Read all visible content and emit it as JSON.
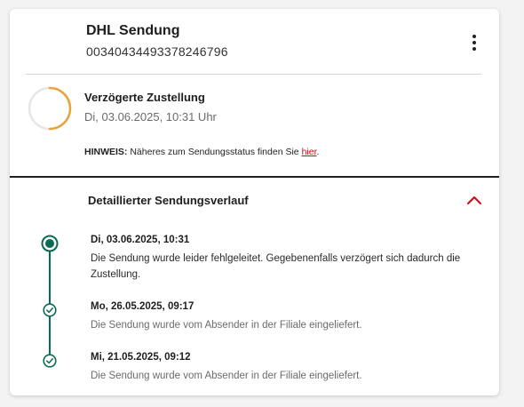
{
  "shipment": {
    "title": "DHL Sendung",
    "tracking_number": "00340434493378246796",
    "menu_icon": "more-vert-icon"
  },
  "status": {
    "title": "Verzögerte Zustellung",
    "date": "Di, 03.06.2025, 10:31 Uhr",
    "ring_color": "#e8a33d",
    "ring_track_color": "#e6e6e6"
  },
  "hint": {
    "label": "HINWEIS:",
    "text": "Näheres zum Sendungsstatus finden Sie",
    "link": "hier",
    "suffix": ".",
    "link_color": "#d40511"
  },
  "history": {
    "title": "Detaillierter Sendungsverlauf",
    "toggle_icon": "chevron-up-icon",
    "accent_color": "#0a6b55",
    "events": [
      {
        "date": "Di, 03.06.2025, 10:31",
        "text": "Die Sendung wurde leider fehlgeleitet. Gegebenenfalls verzögert sich dadurch die Zustellung.",
        "state": "current"
      },
      {
        "date": "Mo, 26.05.2025, 09:17",
        "text": "Die Sendung wurde vom Absender in der Filiale eingeliefert.",
        "state": "done"
      },
      {
        "date": "Mi, 21.05.2025, 09:12",
        "text": "Die Sendung wurde vom Absender in der Filiale eingeliefert.",
        "state": "done"
      }
    ]
  }
}
